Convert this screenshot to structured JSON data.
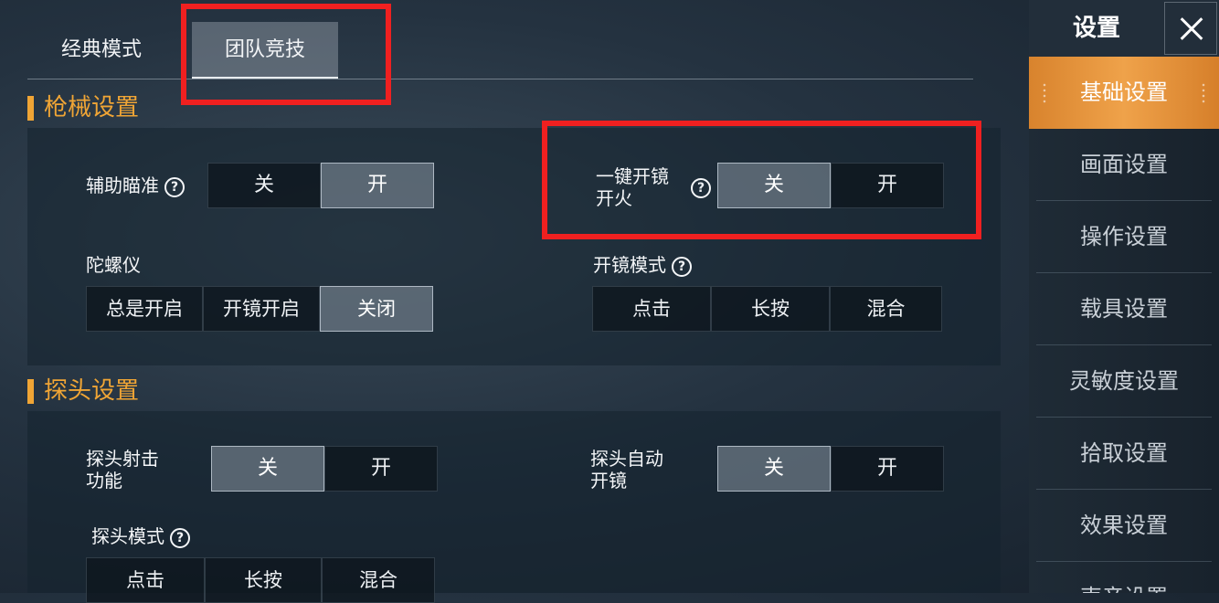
{
  "mode_tabs": [
    {
      "label": "经典模式",
      "selected": false
    },
    {
      "label": "团队竞技",
      "selected": true
    }
  ],
  "gun_section": {
    "title": "枪械设置",
    "aim_assist": {
      "label": "辅助瞄准",
      "options": [
        "关",
        "开"
      ],
      "selected": "开"
    },
    "one_tap_scope_fire": {
      "label_line1": "一键开镜",
      "label_line2": "开火",
      "options": [
        "关",
        "开"
      ],
      "selected": "关"
    },
    "gyroscope": {
      "label": "陀螺仪",
      "options": [
        "总是开启",
        "开镜开启",
        "关闭"
      ],
      "selected": "关闭"
    },
    "scope_mode": {
      "label": "开镜模式",
      "options": [
        "点击",
        "长按",
        "混合"
      ],
      "selected": "点击"
    }
  },
  "peek_section": {
    "title": "探头设置",
    "peek_fire": {
      "label_line1": "探头射击",
      "label_line2": "功能",
      "options": [
        "关",
        "开"
      ],
      "selected": "关"
    },
    "peek_auto_scope": {
      "label_line1": "探头自动",
      "label_line2": "开镜",
      "options": [
        "关",
        "开"
      ],
      "selected": "关"
    },
    "peek_mode": {
      "label": "探头模式",
      "options": [
        "点击",
        "长按",
        "混合"
      ],
      "selected": "点击"
    }
  },
  "help_glyph": "?",
  "sidebar": {
    "title": "设置",
    "close_glyph": "✕",
    "items": [
      {
        "label": "基础设置",
        "active": true
      },
      {
        "label": "画面设置",
        "active": false
      },
      {
        "label": "操作设置",
        "active": false
      },
      {
        "label": "载具设置",
        "active": false
      },
      {
        "label": "灵敏度设置",
        "active": false
      },
      {
        "label": "拾取设置",
        "active": false
      },
      {
        "label": "效果设置",
        "active": false
      },
      {
        "label": "声音设置",
        "active": false
      }
    ]
  },
  "colors": {
    "accent": "#f0a535",
    "highlight": "#f02020",
    "active_tab": "#e8a040"
  }
}
